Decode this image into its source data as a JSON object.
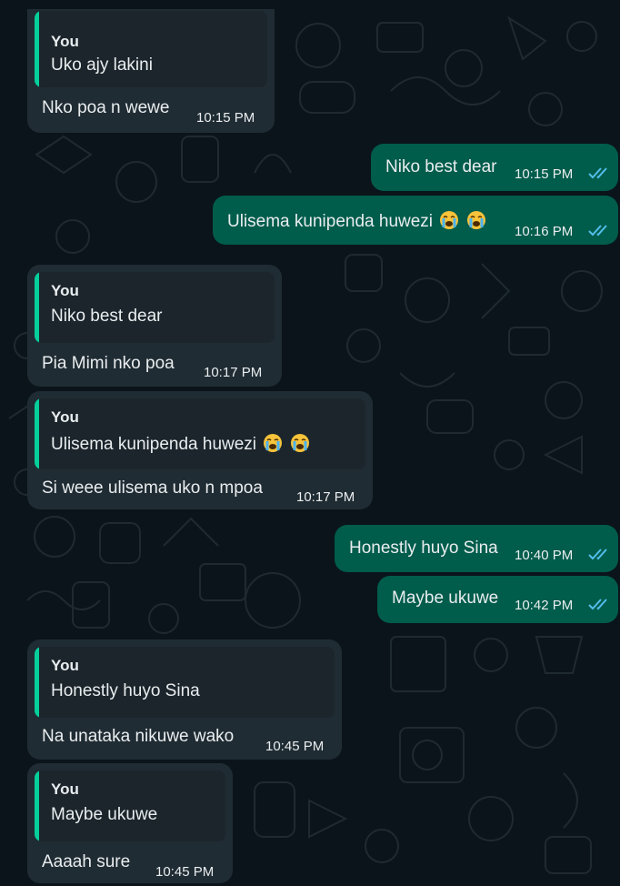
{
  "colors": {
    "background": "#0b141a",
    "incoming_bubble": "#202c33",
    "outgoing_bubble": "#005c4b",
    "quote_bar": "#06cf9c",
    "read_ticks": "#53bdeb"
  },
  "messages": [
    {
      "direction": "incoming",
      "quote_author": "You",
      "quote_text": "Uko ajy lakini",
      "text": "Nko poa n wewe",
      "time": "10:15 PM"
    },
    {
      "direction": "outgoing",
      "text": "Niko best dear",
      "time": "10:15 PM",
      "status_icon": "double-check-read-icon"
    },
    {
      "direction": "outgoing",
      "text": "Ulisema kunipenda huwezi",
      "emoji": "loudly-crying-face-icon",
      "time": "10:16 PM",
      "status_icon": "double-check-read-icon"
    },
    {
      "direction": "incoming",
      "quote_author": "You",
      "quote_text": "Niko best dear",
      "text": "Pia Mimi nko poa",
      "time": "10:17 PM"
    },
    {
      "direction": "incoming",
      "quote_author": "You",
      "quote_text": "Ulisema kunipenda huwezi",
      "quote_emoji": "loudly-crying-face-icon",
      "text": "Si weee ulisema uko n mpoa",
      "time": "10:17 PM"
    },
    {
      "direction": "outgoing",
      "text": "Honestly huyo Sina",
      "time": "10:40 PM",
      "status_icon": "double-check-read-icon"
    },
    {
      "direction": "outgoing",
      "text": "Maybe ukuwe",
      "time": "10:42 PM",
      "status_icon": "double-check-read-icon"
    },
    {
      "direction": "incoming",
      "quote_author": "You",
      "quote_text": "Honestly huyo Sina",
      "text": "Na unataka nikuwe wako",
      "time": "10:45 PM"
    },
    {
      "direction": "incoming",
      "quote_author": "You",
      "quote_text": "Maybe ukuwe",
      "text": "Aaaah sure",
      "time": "10:45 PM"
    }
  ]
}
